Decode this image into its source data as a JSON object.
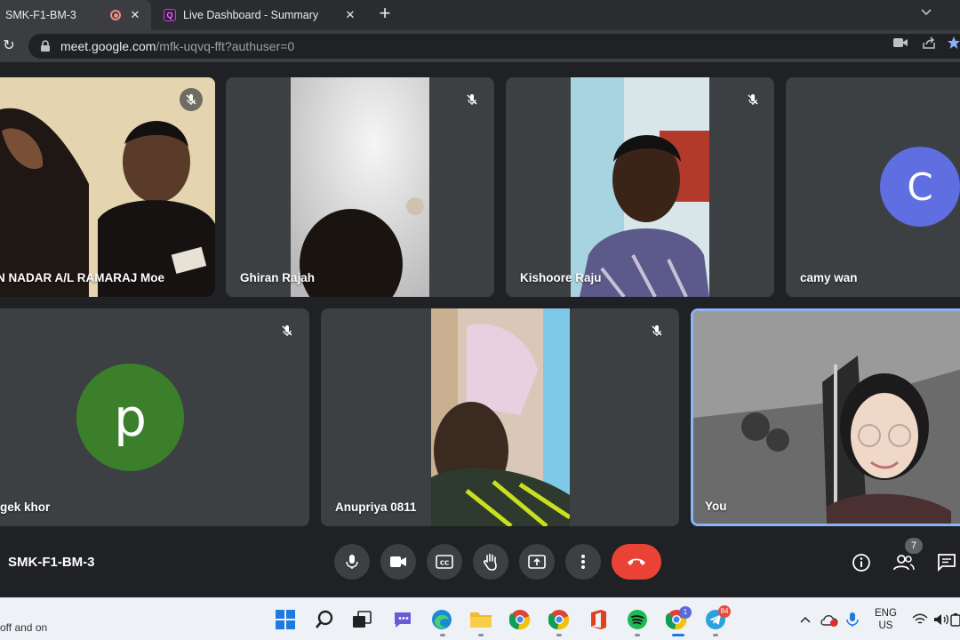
{
  "browser": {
    "tabs": [
      {
        "title": "SMK-F1-BM-3",
        "active": true
      },
      {
        "title": "Live Dashboard - Summary",
        "active": false
      }
    ],
    "new_tab_label": "+",
    "url_host": "meet.google.com",
    "url_path": "/mfk-uqvq-fft?authuser=0"
  },
  "meet": {
    "participants": [
      {
        "name": "N NADAR A/L RAMARAJ Moe",
        "muted": true,
        "camera_on": true
      },
      {
        "name": "Ghiran Rajah",
        "muted": true,
        "camera_on": true
      },
      {
        "name": "Kishoore Raju",
        "muted": true,
        "camera_on": true
      },
      {
        "name": "camy wan",
        "muted": false,
        "camera_on": false,
        "avatar_letter": "C",
        "avatar_color": "#5f6ee0"
      },
      {
        "name": "gek khor",
        "muted": true,
        "camera_on": false,
        "avatar_letter": "p",
        "avatar_color": "#3c7f2a"
      },
      {
        "name": "Anupriya 0811",
        "muted": true,
        "camera_on": true
      },
      {
        "name": "You",
        "muted": false,
        "camera_on": true,
        "highlighted": true
      }
    ],
    "meeting_code": "SMK-F1-BM-3",
    "people_count": "7",
    "accent_color": "#8ab4f8",
    "hangup_color": "#ea4335"
  },
  "taskbar": {
    "left_text": "off and on",
    "lang_line1": "ENG",
    "lang_line2": "US",
    "chrome_badge": "1",
    "telegram_badge": "84"
  }
}
